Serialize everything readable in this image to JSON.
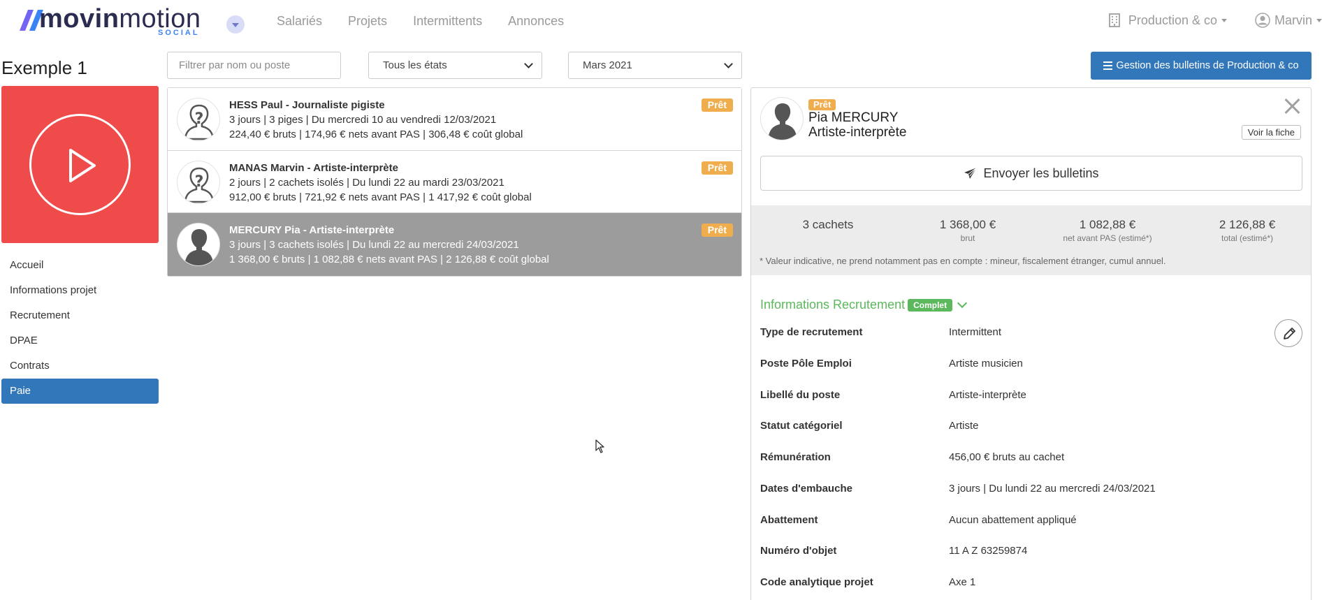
{
  "brand": {
    "name_bold": "movin",
    "name_light": "motion",
    "sub": "SOCIAL",
    "color": "#2b2d50",
    "accent": "#3b82f6"
  },
  "nav": {
    "links": [
      "Salariés",
      "Projets",
      "Intermittents",
      "Annonces"
    ],
    "organization": "Production & co",
    "user": "Marvin"
  },
  "project": {
    "title": "Exemple 1",
    "menu": [
      "Accueil",
      "Informations projet",
      "Recrutement",
      "DPAE",
      "Contrats",
      "Paie"
    ],
    "active_item": "Paie"
  },
  "filters": {
    "search_placeholder": "Filtrer par nom ou poste",
    "state_selected": "Tous les états",
    "month_selected": "Mars 2021"
  },
  "actions": {
    "bulletins_button": "Gestion des bulletins de Production & co"
  },
  "employees": [
    {
      "name": "HESS Paul - Journaliste pigiste",
      "line2": "3 jours | 3 piges | Du mercredi 10 au vendredi 12/03/2021",
      "line3": "224,40 € bruts | 174,96 € nets avant PAS | 306,48 € coût global",
      "status": "Prêt",
      "avatar": "unknown-person-icon"
    },
    {
      "name": "MANAS Marvin - Artiste-interprète",
      "line2": "2 jours | 2 cachets isolés | Du lundi 22 au mardi 23/03/2021",
      "line3": "912,00 € bruts | 721,92 € nets avant PAS | 1 417,92 € coût global",
      "status": "Prêt",
      "avatar": "unknown-person-icon"
    },
    {
      "name": "MERCURY Pia - Artiste-interprète",
      "line2": "3 jours | 3 cachets isolés | Du lundi 22 au mercredi 24/03/2021",
      "line3": "1 368,00 € bruts | 1 082,88 € nets avant PAS | 2 126,88 € coût global",
      "status": "Prêt",
      "avatar": "person-silhouette-icon",
      "selected": true
    }
  ],
  "detail": {
    "status": "Prêt",
    "name": "Pia MERCURY",
    "role": "Artiste-interprète",
    "view_sheet": "Voir la fiche",
    "send_button": "Envoyer les bulletins",
    "stats": [
      {
        "value": "3 cachets",
        "label": ""
      },
      {
        "value": "1 368,00 €",
        "label": "brut"
      },
      {
        "value": "1 082,88 €",
        "label": "net avant PAS (estimé*)"
      },
      {
        "value": "2 126,88 €",
        "label": "total (estimé*)"
      }
    ],
    "note": "* Valeur indicative, ne prend notamment pas en compte : mineur, fiscalement étranger, cumul annuel.",
    "section_title": "Informations Recrutement",
    "section_badge": "Complet",
    "fields": [
      {
        "key": "Type de recrutement",
        "value": "Intermittent"
      },
      {
        "key": "Poste Pôle Emploi",
        "value": "Artiste musicien"
      },
      {
        "key": "Libellé du poste",
        "value": "Artiste-interprète"
      },
      {
        "key": "Statut catégoriel",
        "value": "Artiste"
      },
      {
        "key": "Rémunération",
        "value": "456,00 € bruts au cachet"
      },
      {
        "key": "Dates d'embauche",
        "value": "3 jours | Du lundi 22 au mercredi 24/03/2021"
      },
      {
        "key": "Abattement",
        "value": "Aucun abattement appliqué"
      },
      {
        "key": "Numéro d'objet",
        "value": "11 A Z 63259874"
      },
      {
        "key": "Code analytique projet",
        "value": "Axe 1"
      }
    ]
  },
  "colors": {
    "primary": "#3377bb",
    "warning": "#f0ad4e",
    "success": "#5cb85c",
    "danger": "#ef4b4b",
    "selected_row": "#9c9c9c"
  }
}
